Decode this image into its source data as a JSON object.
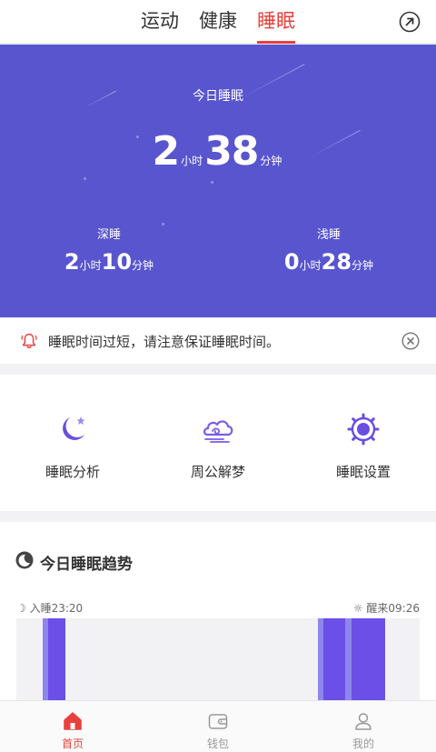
{
  "header": {
    "tabs": [
      {
        "label": "运动"
      },
      {
        "label": "健康"
      },
      {
        "label": "睡眠"
      }
    ],
    "active_tab": 2,
    "share_icon": "share-arrow-icon"
  },
  "hero": {
    "title": "今日睡眠",
    "total": {
      "hours": "2",
      "hours_unit": "小时",
      "minutes": "38",
      "minutes_unit": "分钟"
    },
    "deep": {
      "label": "深睡",
      "hours": "2",
      "hours_unit": "小时",
      "minutes": "10",
      "minutes_unit": "分钟"
    },
    "light": {
      "label": "浅睡",
      "hours": "0",
      "hours_unit": "小时",
      "minutes": "28",
      "minutes_unit": "分钟"
    },
    "background_color": "#5855cf"
  },
  "notice": {
    "message": "睡眠时间过短，请注意保证睡眠时间。",
    "icon": "bell-icon",
    "close_icon": "close-icon",
    "accent_color": "#e8403c"
  },
  "features": [
    {
      "label": "睡眠分析",
      "icon": "moon-star-icon"
    },
    {
      "label": "周公解梦",
      "icon": "cloud-icon"
    },
    {
      "label": "睡眠设置",
      "icon": "gear-icon"
    }
  ],
  "trend": {
    "title": "今日睡眠趋势",
    "sleep_start": "入睡23:20",
    "wake_time": "醒来09:26"
  },
  "bottom_nav": [
    {
      "label": "首页",
      "icon": "home-icon"
    },
    {
      "label": "钱包",
      "icon": "wallet-icon"
    },
    {
      "label": "我的",
      "icon": "user-icon"
    }
  ],
  "bottom_nav_active": 0
}
